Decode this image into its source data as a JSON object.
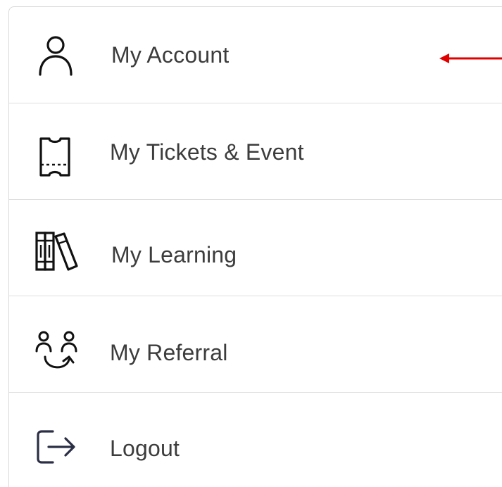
{
  "menu": {
    "items": [
      {
        "label": "My Account",
        "icon": "user-icon"
      },
      {
        "label": "My Tickets & Event",
        "icon": "ticket-icon"
      },
      {
        "label": "My Learning",
        "icon": "books-icon"
      },
      {
        "label": "My Referral",
        "icon": "referral-icon"
      },
      {
        "label": "Logout",
        "icon": "logout-icon"
      }
    ]
  },
  "colors": {
    "text": "#3c3c3c",
    "icon": "#111111",
    "logout_icon": "#2b2f45",
    "annotation_arrow": "#e10000",
    "divider": "#dedede"
  }
}
